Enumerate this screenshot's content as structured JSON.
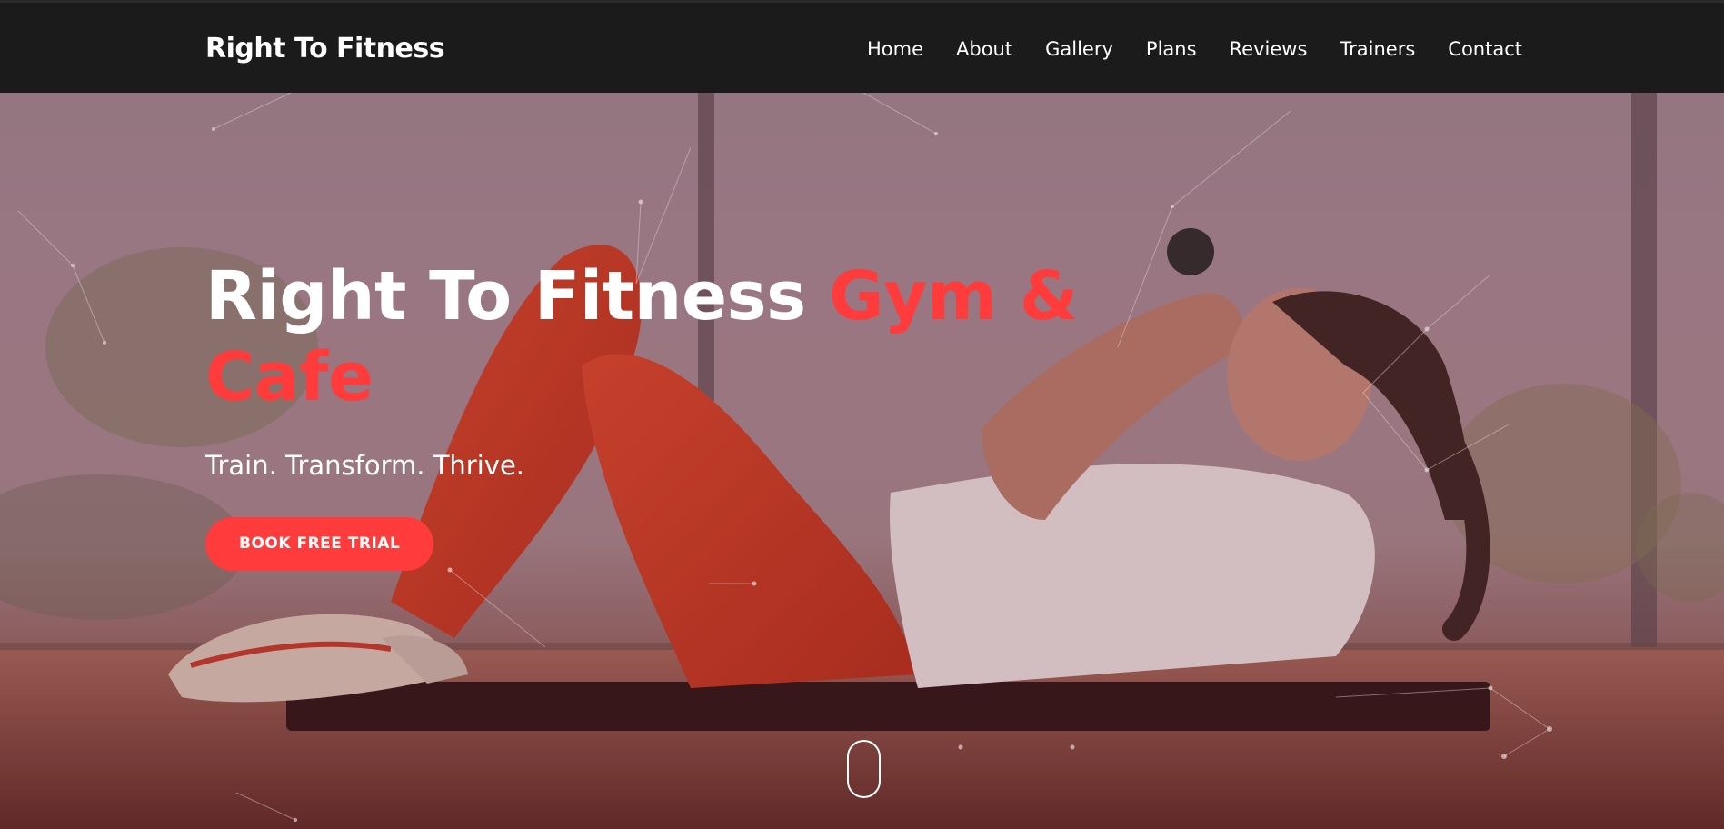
{
  "brand": {
    "name": "Right To Fitness"
  },
  "nav": {
    "items": [
      {
        "label": "Home"
      },
      {
        "label": "About"
      },
      {
        "label": "Gallery"
      },
      {
        "label": "Plans"
      },
      {
        "label": "Reviews"
      },
      {
        "label": "Trainers"
      },
      {
        "label": "Contact"
      }
    ]
  },
  "hero": {
    "title_main": "Right To Fitness ",
    "title_accent": "Gym & Cafe",
    "tagline": "Train. Transform. Thrive.",
    "cta_label": "BOOK FREE TRIAL"
  },
  "colors": {
    "accent": "#ff3b3b",
    "navbar_bg": "#1b1b1b",
    "text": "#ffffff"
  }
}
